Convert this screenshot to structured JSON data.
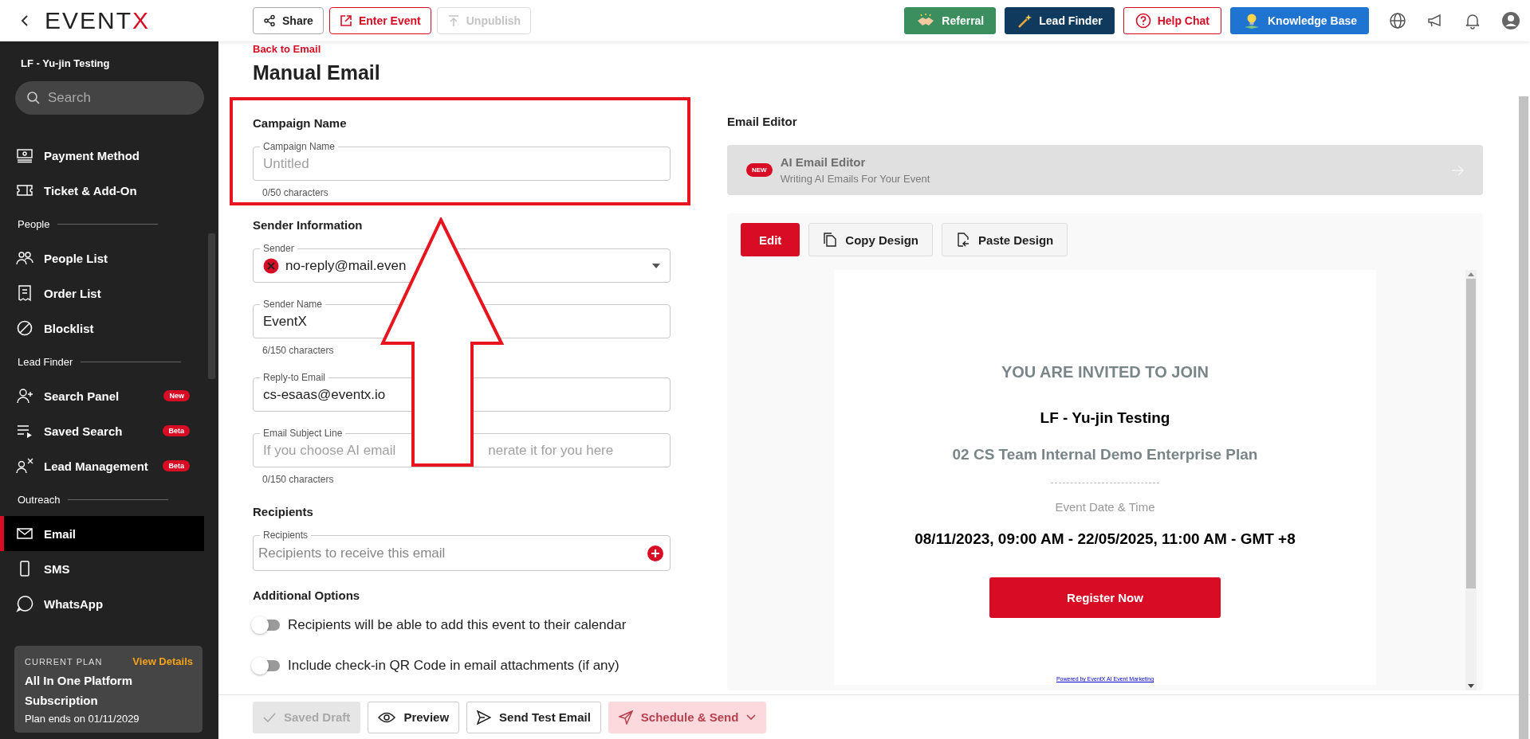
{
  "header": {
    "logo": {
      "text": "EVENT",
      "accent": "X"
    },
    "actions": [
      {
        "label": "Share",
        "kind": "neutral",
        "disabled": false
      },
      {
        "label": "Enter Event",
        "kind": "danger",
        "disabled": false
      },
      {
        "label": "Unpublish",
        "kind": "neutral",
        "disabled": true
      }
    ],
    "promos": [
      {
        "label": "Referral",
        "kind": "solid",
        "color": "#3b8f5f"
      },
      {
        "label": "Lead Finder",
        "kind": "solid",
        "color": "#0f3a5d"
      },
      {
        "label": "Help Chat",
        "kind": "outline",
        "color": "#d80c24"
      },
      {
        "label": "Knowledge Base",
        "kind": "solid",
        "color": "#1f74d1"
      }
    ]
  },
  "sidebar": {
    "event_name": "LF - Yu-jin Testing",
    "search_placeholder": "Search",
    "entries": [
      {
        "kind": "item",
        "label": "Payment Method",
        "selected": false
      },
      {
        "kind": "item",
        "label": "Ticket & Add-On",
        "selected": false
      },
      {
        "kind": "section",
        "label": "People"
      },
      {
        "kind": "item",
        "label": "People List",
        "selected": false
      },
      {
        "kind": "item",
        "label": "Order List",
        "selected": false
      },
      {
        "kind": "item",
        "label": "Blocklist",
        "selected": false
      },
      {
        "kind": "section",
        "label": "Lead Finder"
      },
      {
        "kind": "item",
        "label": "Search Panel",
        "selected": false,
        "badge": "New"
      },
      {
        "kind": "item",
        "label": "Saved Search",
        "selected": false,
        "badge": "Beta"
      },
      {
        "kind": "item",
        "label": "Lead Management",
        "selected": false,
        "badge": "Beta"
      },
      {
        "kind": "section",
        "label": "Outreach"
      },
      {
        "kind": "item",
        "label": "Email",
        "selected": true
      },
      {
        "kind": "item",
        "label": "SMS",
        "selected": false
      },
      {
        "kind": "item",
        "label": "WhatsApp",
        "selected": false
      }
    ],
    "plan": {
      "caption": "CURRENT PLAN",
      "link": "View Details",
      "name": "All In One Platform Subscription",
      "ends": "Plan ends on 01/11/2029"
    }
  },
  "back_link": "Back to Email",
  "title": "Manual Email",
  "campaign": {
    "heading": "Campaign Name",
    "field": {
      "label": "Campaign Name",
      "placeholder": "Untitled",
      "counter": "0/50 characters"
    }
  },
  "sender": {
    "heading": "Sender Information",
    "fields": [
      {
        "kind": "select",
        "label": "Sender",
        "value": "no-reply@mail.even"
      },
      {
        "kind": "text",
        "label": "Sender Name",
        "value": "EventX",
        "counter": "6/150 characters"
      },
      {
        "kind": "text",
        "label": "Reply-to Email",
        "value": "cs-esaas@eventx.io"
      },
      {
        "kind": "split",
        "label": "Email Subject Line",
        "placeholder_parts": [
          "If you choose AI email",
          "nerate it for you here"
        ],
        "counter": "0/150 characters"
      }
    ]
  },
  "recipients": {
    "heading": "Recipients",
    "field": {
      "label": "Recipients",
      "placeholder": "Recipients to receive this email"
    }
  },
  "options": {
    "heading": "Additional Options",
    "toggles": [
      {
        "label": "Recipients will be able to add this event to their calendar",
        "on": false
      },
      {
        "label": "Include check-in QR Code in email attachments (if any)",
        "on": false
      }
    ]
  },
  "editor": {
    "heading": "Email Editor",
    "ai_banner": {
      "badge": "NEW",
      "title": "AI Email Editor",
      "subtitle": "Writing AI Emails For Your Event"
    },
    "tools": [
      {
        "label": "Edit",
        "kind": "primary"
      },
      {
        "label": "Copy Design",
        "kind": "secondary"
      },
      {
        "label": "Paste Design",
        "kind": "secondary"
      }
    ],
    "preview": {
      "invite": "YOU ARE INVITED TO JOIN",
      "event_name": "LF - Yu-jin Testing",
      "subtitle": "02 CS Team Internal Demo Enterprise Plan",
      "date_label": "Event Date & Time",
      "date": "08/11/2023, 09:00 AM - 22/05/2025, 11:00 AM - GMT +8",
      "button": "Register Now",
      "footer": "Powered by EventX AI Event Marketing"
    }
  },
  "footer_actions": [
    {
      "label": "Saved Draft",
      "kind": "neutral",
      "disabled": true
    },
    {
      "label": "Preview",
      "kind": "neutral",
      "disabled": false
    },
    {
      "label": "Send Test Email",
      "kind": "neutral",
      "disabled": false
    },
    {
      "label": "Schedule & Send",
      "kind": "primary",
      "disabled": true
    }
  ]
}
